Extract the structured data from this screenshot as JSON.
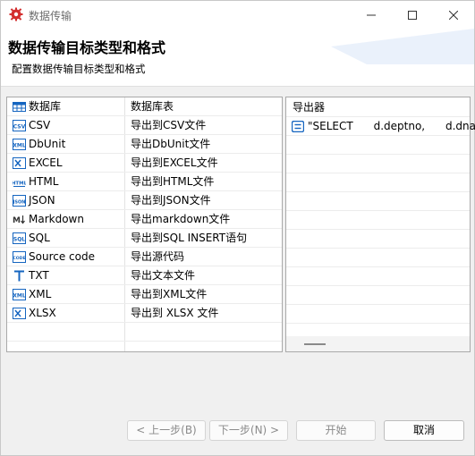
{
  "window": {
    "title": "数据传输"
  },
  "header": {
    "title": "数据传输目标类型和格式",
    "subtitle": "配置数据传输目标类型和格式"
  },
  "left_table": {
    "columns": [
      "数据库",
      "数据库表"
    ],
    "rows": [
      {
        "name": "CSV",
        "desc": "导出到CSV文件",
        "icon": "csv-icon"
      },
      {
        "name": "DbUnit",
        "desc": "导出DbUnit文件",
        "icon": "xml-icon"
      },
      {
        "name": "EXCEL",
        "desc": "导出到EXCEL文件",
        "icon": "excel-icon"
      },
      {
        "name": "HTML",
        "desc": "导出到HTML文件",
        "icon": "html-icon"
      },
      {
        "name": "JSON",
        "desc": "导出到JSON文件",
        "icon": "json-icon"
      },
      {
        "name": "Markdown",
        "desc": "导出markdown文件",
        "icon": "markdown-icon"
      },
      {
        "name": "SQL",
        "desc": "导出到SQL INSERT语句",
        "icon": "sql-icon"
      },
      {
        "name": "Source code",
        "desc": "导出源代码",
        "icon": "code-icon"
      },
      {
        "name": "TXT",
        "desc": "导出文本文件",
        "icon": "txt-icon"
      },
      {
        "name": "XML",
        "desc": "导出到XML文件",
        "icon": "xml-icon"
      },
      {
        "name": "XLSX",
        "desc": "导出到 XLSX 文件",
        "icon": "excel-icon"
      }
    ]
  },
  "right_panel": {
    "header": "导出器",
    "rows": [
      "\"SELECT      d.deptno,      d.dname"
    ]
  },
  "buttons": {
    "back": "< 上一步(B)",
    "next": "下一步(N) >",
    "start": "开始",
    "cancel": "取消"
  },
  "colors": {
    "icon_blue": "#1565c0",
    "app_icon": "#d32f2f"
  }
}
